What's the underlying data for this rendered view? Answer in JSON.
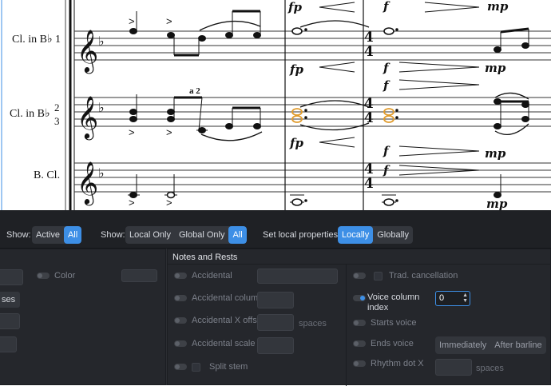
{
  "score": {
    "staff_names": [
      "Cl. in B♭ 1",
      "Cl. in B♭",
      "B. Cl."
    ],
    "staff2_numbers": [
      "2",
      "3"
    ],
    "a2_text": "a 2",
    "time_sig": [
      "4",
      "4"
    ],
    "dynamics": {
      "fp": "fp",
      "f": "f",
      "mp": "mp"
    },
    "glyphs": {
      "treble_clef": "𝄞",
      "flat": "♭",
      "accent": ">"
    }
  },
  "panel": {
    "show1_label": "Show:",
    "show1_options": [
      "Active",
      "All"
    ],
    "show1_selected": "All",
    "show2_label": "Show:",
    "show2_options": [
      "Local Only",
      "Global Only",
      "All"
    ],
    "show2_selected": "All",
    "set_label": "Set local properties:",
    "set_options": [
      "Locally",
      "Globally"
    ],
    "set_selected": "Locally",
    "left_section": {
      "color_label": "Color",
      "partial_button": "ses"
    },
    "notes_section": {
      "title": "Notes and Rests",
      "accidental": "Accidental",
      "accidental_column": "Accidental column",
      "accidental_x_offset": "Accidental X offset",
      "spaces": "spaces",
      "accidental_scale": "Accidental scale",
      "split_stem": "Split stem"
    },
    "right_section": {
      "trad_cancellation": "Trad. cancellation",
      "voice_column_index_1": "Voice column",
      "voice_column_index_2": "index",
      "voice_column_value": "0",
      "starts_voice": "Starts voice",
      "ends_voice": "Ends voice",
      "ends_options": [
        "Immediately",
        "After barline"
      ],
      "rhythm_dot_x": "Rhythm dot X",
      "spaces": "spaces"
    }
  }
}
